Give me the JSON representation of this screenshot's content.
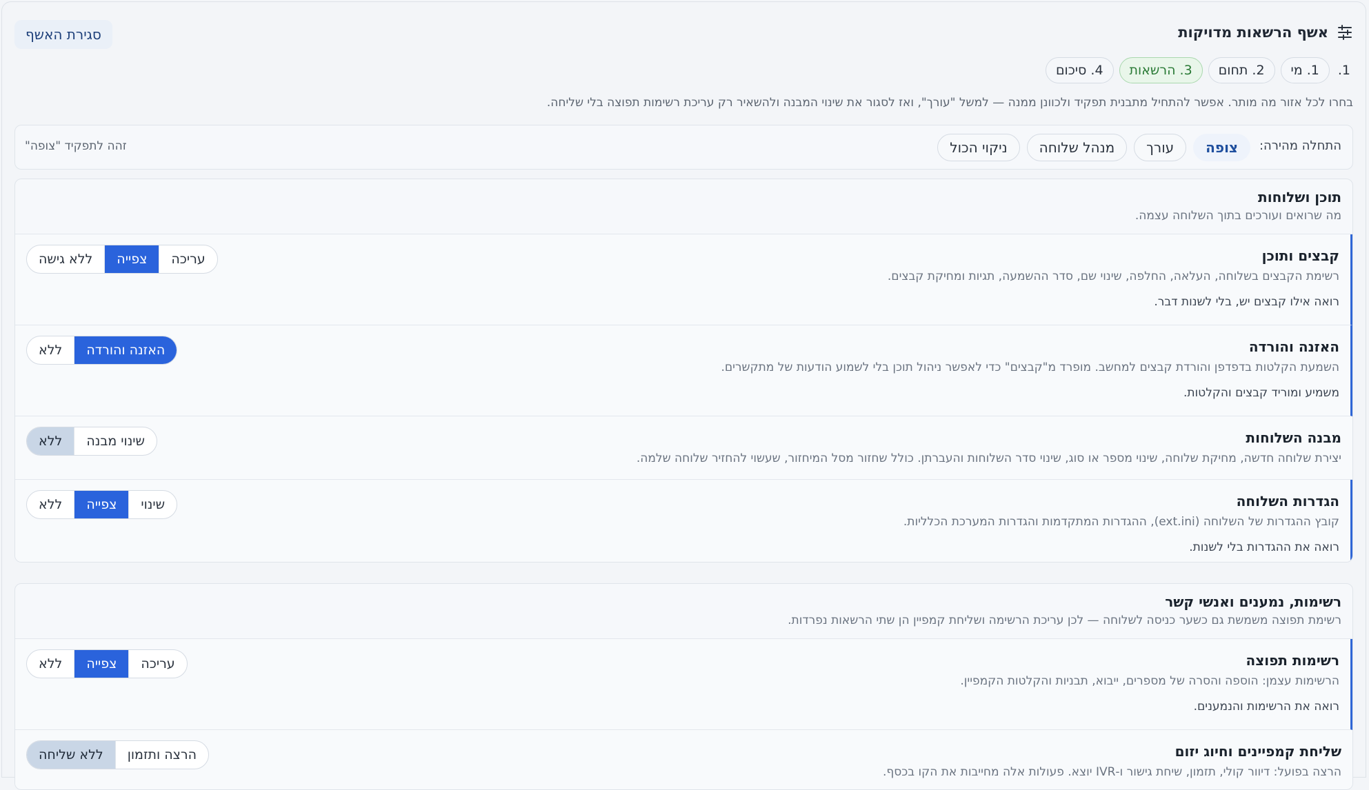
{
  "header": {
    "title": "אשף הרשאות מדויקות",
    "close_label": "סגירת האשף"
  },
  "steps": [
    {
      "label": "1.",
      "active": false
    },
    {
      "label": "1. מי",
      "active": false
    },
    {
      "label": "2. תחום",
      "active": false
    },
    {
      "label": "3. הרשאות",
      "active": true
    },
    {
      "label": "4. סיכום",
      "active": false
    }
  ],
  "hint": "בחרו לכל אזור מה מותר. אפשר להתחיל מתבנית תפקיד ולכוונן ממנה — למשל \"עורך\", ואז לסגור את שינוי המבנה ולהשאיר רק עריכת רשימות תפוצה בלי שליחה.",
  "quick_start": {
    "label": "התחלה מהירה:",
    "buttons": [
      "צופה",
      "עורך",
      "מנהל שלוחה",
      "ניקוי הכול"
    ],
    "active": "צופה",
    "status": "זהה לתפקיד \"צופה\""
  },
  "sections": [
    {
      "title": "תוכן ושלוחות",
      "description": "מה שרואים ועורכים בתוך השלוחה עצמה.",
      "rows": [
        {
          "title": "קבצים ותוכן",
          "description": "רשימת הקבצים בשלוחה, העלאה, החלפה, שינוי שם, סדר ההשמעה, תגיות ומחיקת קבצים.",
          "effect": "רואה אילו קבצים יש, בלי לשנות דבר.",
          "options": [
            "ללא גישה",
            "צפייה",
            "עריכה"
          ],
          "selected": "צפייה"
        },
        {
          "title": "האזנה והורדה",
          "description": "השמעת הקלטות בדפדפן והורדת קבצים למחשב. מופרד מ\"קבצים\" כדי לאפשר ניהול תוכן בלי לשמוע הודעות של מתקשרים.",
          "effect": "משמיע ומוריד קבצים והקלטות.",
          "options": [
            "ללא",
            "האזנה והורדה"
          ],
          "selected": "האזנה והורדה"
        },
        {
          "title": "מבנה השלוחות",
          "description": "יצירת שלוחה חדשה, מחיקת שלוחה, שינוי מספר או סוג, שינוי סדר השלוחות והעברתן. כולל שחזור מסל המיחזור, שעשוי להחזיר שלוחה שלמה.",
          "effect": "",
          "options": [
            "ללא",
            "שינוי מבנה"
          ],
          "selected": "ללא"
        },
        {
          "title": "הגדרות השלוחה",
          "description": "קובץ ההגדרות של השלוחה (ext.ini), ההגדרות המתקדמות והגדרות המערכת הכלליות.",
          "effect": "רואה את ההגדרות בלי לשנות.",
          "options": [
            "ללא",
            "צפייה",
            "שינוי"
          ],
          "selected": "צפייה"
        }
      ]
    },
    {
      "title": "רשימות, נמענים ואנשי קשר",
      "description": "רשימת תפוצה משמשת גם כשער כניסה לשלוחה — לכן עריכת הרשימה ושליחת קמפיין הן שתי הרשאות נפרדות.",
      "rows": [
        {
          "title": "רשימות תפוצה",
          "description": "הרשימות עצמן: הוספה והסרה של מספרים, ייבוא, תבניות והקלטות הקמפיין.",
          "effect": "רואה את הרשימות והנמענים.",
          "options": [
            "ללא",
            "צפייה",
            "עריכה"
          ],
          "selected": "צפייה"
        },
        {
          "title": "שליחת קמפיינים וחיוג יזום",
          "description": "הרצה בפועל: דיוור קולי, תזמון, שיחת גישור ו-IVR יוצא. פעולות אלה מחייבות את הקו בכסף.",
          "effect": "",
          "options": [
            "ללא שליחה",
            "הרצה ותזמון"
          ],
          "selected": "ללא שליחה"
        }
      ]
    }
  ]
}
